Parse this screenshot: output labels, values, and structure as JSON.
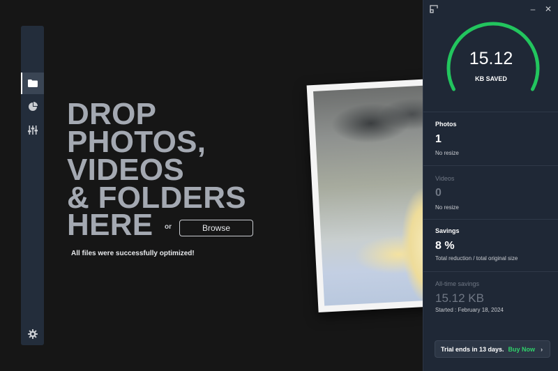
{
  "sidebar": {
    "items": [
      {
        "name": "folder",
        "icon": "folder-icon",
        "active": true
      },
      {
        "name": "stats",
        "icon": "pie-chart-icon",
        "active": false
      },
      {
        "name": "adjust",
        "icon": "sliders-icon",
        "active": false
      }
    ],
    "settings_icon": "gear-icon"
  },
  "drop_zone": {
    "lines": [
      "DROP",
      "PHOTOS,",
      "VIDEOS",
      "& FOLDERS",
      "HERE"
    ],
    "or_text": "or",
    "browse_label": "Browse",
    "status_message": "All files were successfully optimized!"
  },
  "summary": {
    "gauge_value": "15.12",
    "gauge_unit": "KB SAVED",
    "gauge_color": "#22c55e"
  },
  "stats": {
    "photos": {
      "label": "Photos",
      "value": "1",
      "sub": "No resize"
    },
    "videos": {
      "label": "Videos",
      "value": "0",
      "sub": "No resize"
    },
    "savings": {
      "label": "Savings",
      "value": "8 %",
      "sub": "Total reduction / total original size"
    },
    "all_time": {
      "label": "All-time savings",
      "value": "15.12 KB",
      "sub": "Started : February 18, 2024"
    }
  },
  "trial": {
    "text": "Trial ends in 13 days.",
    "cta": "Buy Now",
    "chevron": "›"
  },
  "window": {
    "minimize": "–",
    "close": "✕"
  },
  "colors": {
    "accent_green": "#2fd06a",
    "panel_bg": "#1f2836",
    "rail_bg": "#232d3b"
  }
}
